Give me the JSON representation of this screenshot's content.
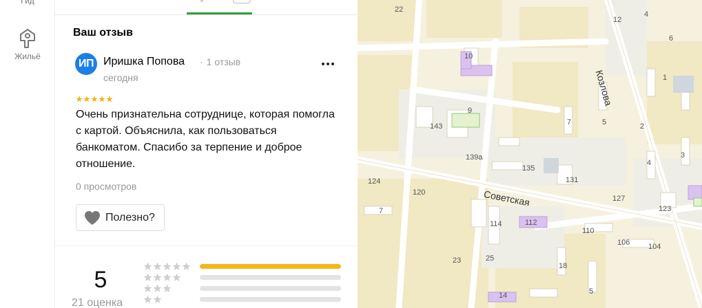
{
  "rail": {
    "items": [
      {
        "label": "Гид"
      },
      {
        "label": "Жильё"
      }
    ]
  },
  "panel": {
    "section_title": "Ваш отзыв",
    "review": {
      "avatar_initials": "ИП",
      "author": "Иришка Попова",
      "author_reviews": "1 отзыв",
      "date": "сегодня",
      "rating": 5,
      "text": "Очень признательна сотруднице, которая помогла с картой. Объяснила, как пользоваться банкоматом. Спасибо за терпение и доброе отношение.",
      "views": "0 просмотров",
      "helpful_label": "Полезно?"
    },
    "summary": {
      "average": "5",
      "count_label": "21 оценка",
      "distribution": [
        {
          "stars": 5,
          "share": 1.0
        },
        {
          "stars": 4,
          "share": 0
        },
        {
          "stars": 3,
          "share": 0
        },
        {
          "stars": 2,
          "share": 0
        }
      ]
    }
  },
  "colors": {
    "accent_green": "#2e9e3a",
    "avatar_blue": "#1b7fe8",
    "star_yellow": "#f7b51b",
    "star_empty": "#cfcfcf"
  },
  "map": {
    "street_labels": [
      "Советская",
      "Козлова"
    ],
    "house_numbers": [
      "22",
      "12",
      "4",
      "6",
      "10",
      "1",
      "9",
      "143",
      "7",
      "5",
      "2",
      "139а",
      "135",
      "131",
      "3",
      "4",
      "124",
      "120",
      "127",
      "123",
      "7",
      "114",
      "112",
      "110",
      "106",
      "104",
      "23",
      "25",
      "18",
      "14",
      "5"
    ]
  }
}
